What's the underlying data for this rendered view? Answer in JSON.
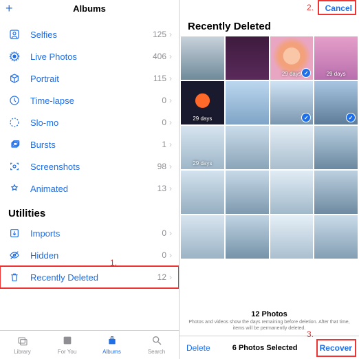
{
  "colors": {
    "accent": "#1e6fe8",
    "annotation": "#e33333"
  },
  "left": {
    "header_title": "Albums",
    "add_label": "+",
    "media_types": [
      {
        "icon": "person-crop-square",
        "label": "Selfies",
        "count": "125"
      },
      {
        "icon": "live-photo",
        "label": "Live Photos",
        "count": "406"
      },
      {
        "icon": "cube",
        "label": "Portrait",
        "count": "115"
      },
      {
        "icon": "timelapse",
        "label": "Time-lapse",
        "count": "0"
      },
      {
        "icon": "slowmo",
        "label": "Slo-mo",
        "count": "0"
      },
      {
        "icon": "burst",
        "label": "Bursts",
        "count": "1"
      },
      {
        "icon": "camera-viewfinder",
        "label": "Screenshots",
        "count": "98"
      },
      {
        "icon": "animated",
        "label": "Animated",
        "count": "13"
      }
    ],
    "utilities_header": "Utilities",
    "utilities": [
      {
        "icon": "square-arrow-down",
        "label": "Imports",
        "count": "0"
      },
      {
        "icon": "eye-slash",
        "label": "Hidden",
        "count": "0"
      },
      {
        "icon": "trash",
        "label": "Recently Deleted",
        "count": "12"
      }
    ],
    "tabs": [
      {
        "icon": "photo-on-rectangle",
        "label": "Library"
      },
      {
        "icon": "heart-square",
        "label": "For You"
      },
      {
        "icon": "rectangle-stack",
        "label": "Albums",
        "active": true
      },
      {
        "icon": "magnifyingglass",
        "label": "Search"
      }
    ],
    "annotation": "1."
  },
  "right": {
    "cancel": "Cancel",
    "title": "Recently Deleted",
    "annotation_cancel": "2.",
    "annotation_recover": "3.",
    "photos": [
      {
        "days": "",
        "selected": false,
        "fill": "p1"
      },
      {
        "days": "",
        "selected": false,
        "fill": "p2"
      },
      {
        "days": "29 days",
        "selected": true,
        "fill": "p3"
      },
      {
        "days": "29 days",
        "selected": false,
        "fill": "p4"
      },
      {
        "days": "29 days",
        "selected": false,
        "fill": "p5"
      },
      {
        "days": "",
        "selected": false,
        "fill": "p6"
      },
      {
        "days": "",
        "selected": true,
        "fill": "p7"
      },
      {
        "days": "",
        "selected": true,
        "fill": "p8"
      },
      {
        "days": "29 days",
        "selected": false,
        "fill": "p9"
      },
      {
        "days": "",
        "selected": false,
        "fill": "p10"
      },
      {
        "days": "",
        "selected": false,
        "fill": "p11"
      },
      {
        "days": "",
        "selected": false,
        "fill": "p12"
      },
      {
        "days": "",
        "selected": false,
        "fill": "p13"
      },
      {
        "days": "",
        "selected": false,
        "fill": "p14"
      },
      {
        "days": "",
        "selected": false,
        "fill": "p15"
      },
      {
        "days": "",
        "selected": false,
        "fill": "p16"
      },
      {
        "days": "",
        "selected": false,
        "fill": "p17"
      },
      {
        "days": "",
        "selected": false,
        "fill": "p18"
      },
      {
        "days": "",
        "selected": false,
        "fill": "p19"
      },
      {
        "days": "",
        "selected": false,
        "fill": "p20"
      }
    ],
    "footer_count": "12 Photos",
    "footer_note": "Photos and videos show the days remaining before deletion. After that time, items will be permanently deleted.",
    "action_delete": "Delete",
    "selection_status": "6 Photos Selected",
    "action_recover": "Recover"
  }
}
